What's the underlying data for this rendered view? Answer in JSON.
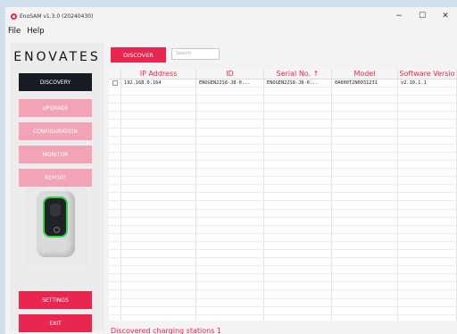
{
  "window": {
    "title": "EnoSAM v1.3.0 (20240430)",
    "controls": [
      "−",
      "☐",
      "✕"
    ]
  },
  "menu": [
    "File",
    "Help"
  ],
  "brand": {
    "logo": "ENOVATES"
  },
  "sidebar": {
    "items": [
      {
        "label": "DISCOVERY",
        "state": "active"
      },
      {
        "label": "UPGRADE",
        "state": "disabled"
      },
      {
        "label": "CONFIGURATION",
        "state": "disabled"
      },
      {
        "label": "MONITOR",
        "state": "disabled"
      },
      {
        "label": "REPORT",
        "state": "disabled"
      }
    ],
    "settings": "SETTINGS",
    "exit": "EXIT"
  },
  "toolbar": {
    "discover": "DISCOVER",
    "search_placeholder": "Search"
  },
  "table": {
    "columns": [
      "IP Address",
      "ID",
      "Serial No.  ↑",
      "Model",
      "Software Versio"
    ],
    "rows": [
      [
        "192.168.0.164",
        "ENOGEN22S8-J8-0...",
        "ENOGEN22S8-J8-0...",
        "0A000T2N0031231",
        "v2.10.1.1"
      ]
    ]
  },
  "status": {
    "text": "Discovered charging stations  1"
  },
  "colors": {
    "accent": "#e8264f",
    "active": "#181b22",
    "disabled": "#f2a3b6"
  }
}
